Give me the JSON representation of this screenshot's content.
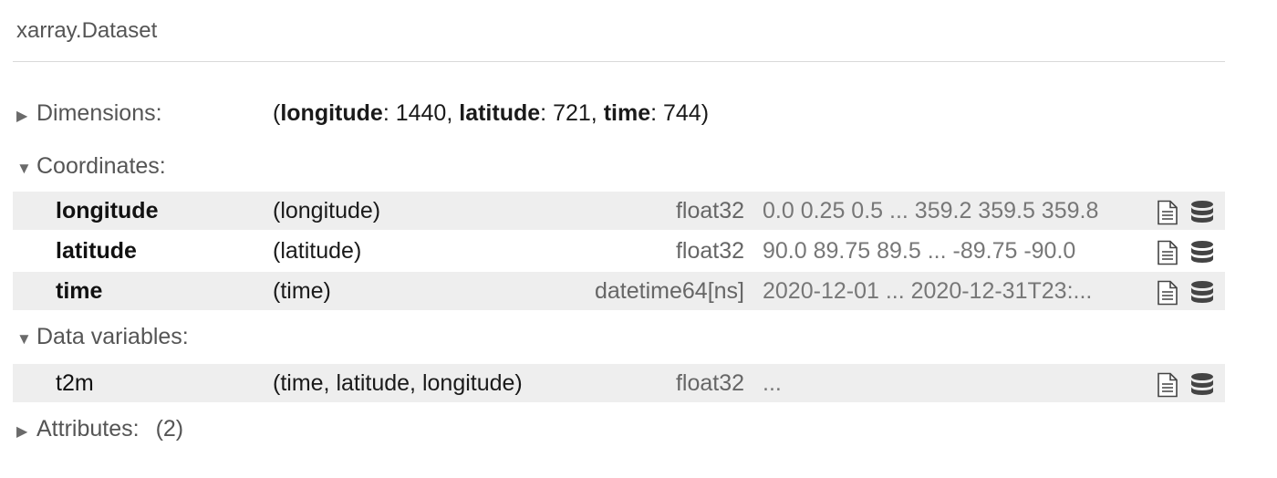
{
  "title": "xarray.Dataset",
  "sections": {
    "dimensions": {
      "label": "Dimensions:",
      "arrow": "▶",
      "open_paren": "(",
      "close_paren": ")",
      "items": [
        {
          "name": "longitude",
          "value": "1440"
        },
        {
          "name": "latitude",
          "value": "721"
        },
        {
          "name": "time",
          "value": "744"
        }
      ]
    },
    "coordinates": {
      "label": "Coordinates:",
      "arrow": "▼",
      "rows": [
        {
          "name": "longitude",
          "dims": "(longitude)",
          "dtype": "float32",
          "preview": "0.0 0.25 0.5 ... 359.2 359.5 359.8"
        },
        {
          "name": "latitude",
          "dims": "(latitude)",
          "dtype": "float32",
          "preview": "90.0 89.75 89.5 ... -89.75 -90.0"
        },
        {
          "name": "time",
          "dims": "(time)",
          "dtype": "datetime64[ns]",
          "preview": "2020-12-01 ... 2020-12-31T23:..."
        }
      ]
    },
    "data_variables": {
      "label": "Data variables:",
      "arrow": "▼",
      "rows": [
        {
          "name": "t2m",
          "dims": "(time, latitude, longitude)",
          "dtype": "float32",
          "preview": "..."
        }
      ]
    },
    "attributes": {
      "label": "Attributes:",
      "arrow": "▶",
      "count": "(2)"
    }
  },
  "icons": {
    "attributes": "file-text-icon",
    "data_repr": "database-icon"
  },
  "colors": {
    "row_shade": "#eeeeee",
    "section_text": "#555555",
    "muted_text": "#777777"
  }
}
